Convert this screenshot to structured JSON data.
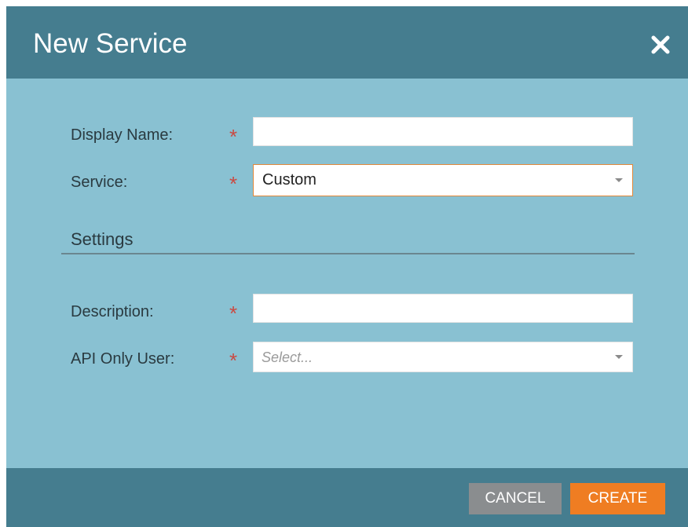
{
  "dialog": {
    "title": "New Service",
    "close_icon": "close-icon"
  },
  "form": {
    "display_name": {
      "label": "Display Name:",
      "required_mark": "*",
      "value": ""
    },
    "service": {
      "label": "Service:",
      "required_mark": "*",
      "selected": "Custom"
    },
    "section_title": "Settings",
    "description": {
      "label": "Description:",
      "required_mark": "*",
      "value": ""
    },
    "api_only_user": {
      "label": "API Only User:",
      "required_mark": "*",
      "placeholder": "Select..."
    }
  },
  "footer": {
    "cancel_label": "CANCEL",
    "create_label": "CREATE"
  },
  "colors": {
    "header": "#457d8f",
    "body": "#89c1d2",
    "required": "#c94a43",
    "create_button": "#ef7d22",
    "cancel_button": "#8a8d8f",
    "focused_border": "#e2883a"
  }
}
